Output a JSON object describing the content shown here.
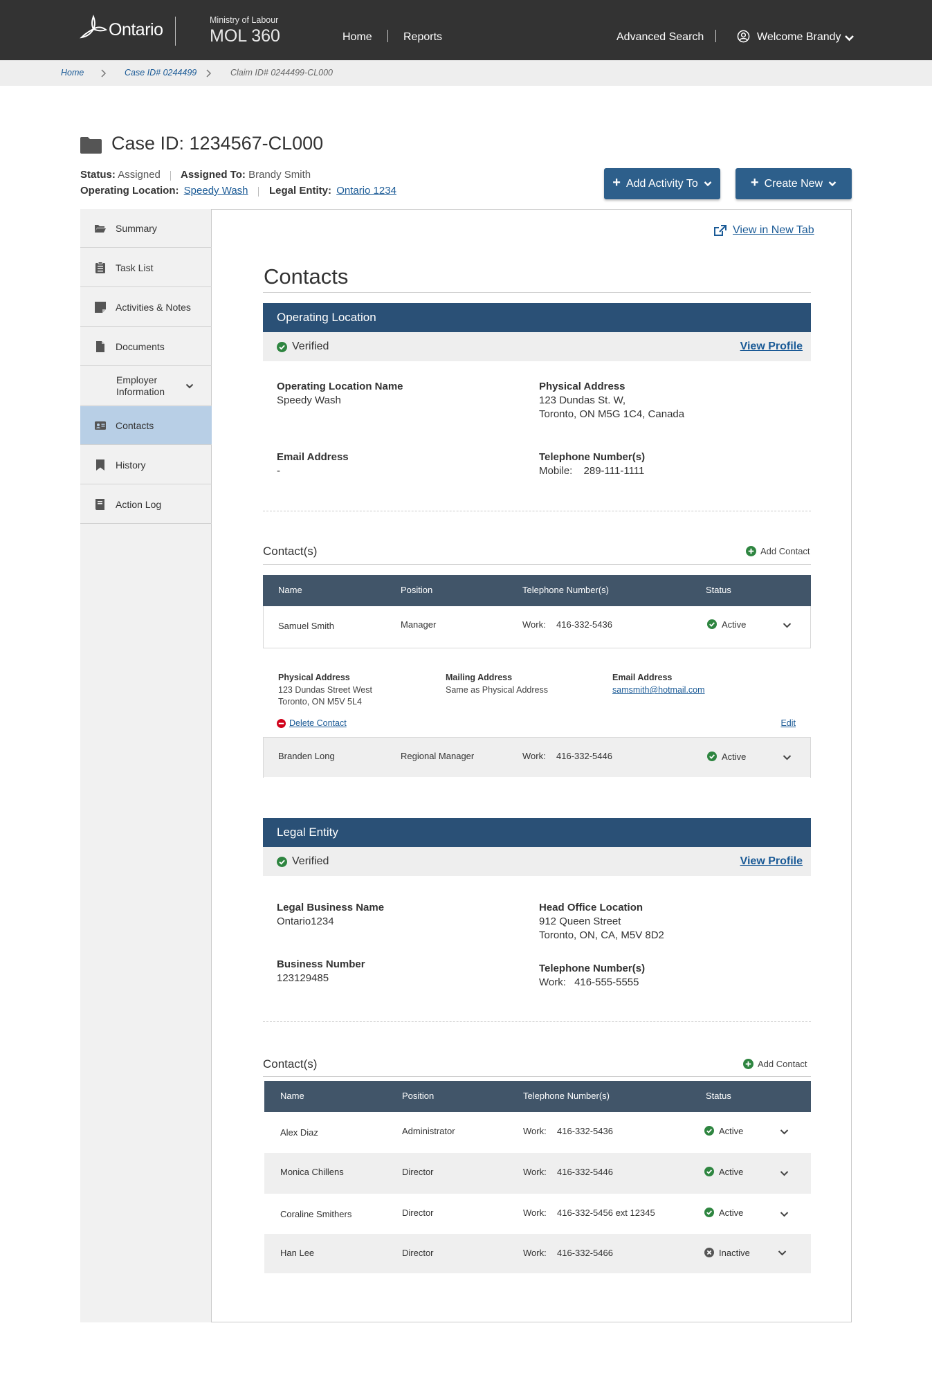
{
  "header": {
    "brand": "Ontario",
    "ministry_small": "Ministry of Labour",
    "ministry_app": "MOL 360",
    "nav_home": "Home",
    "nav_reports": "Reports",
    "advanced_search": "Advanced Search",
    "welcome": "Welcome Brandy"
  },
  "breadcrumb": {
    "home": "Home",
    "case": "Case ID# 0244499",
    "current": "Claim ID# 0244499-CL000"
  },
  "case": {
    "title": "Case ID: 1234567-CL000",
    "status_label": "Status:",
    "status_value": "Assigned",
    "assigned_label": "Assigned To:",
    "assigned_value": "Brandy Smith",
    "op_loc_label": "Operating Location:",
    "op_loc_value": "Speedy Wash",
    "legal_label": "Legal Entity:",
    "legal_value": "Ontario 1234",
    "add_activity": "Add Activity To",
    "create_new": "Create New"
  },
  "sidebar": {
    "items": [
      {
        "label": "Summary",
        "icon": "folder-open-icon"
      },
      {
        "label": "Task List",
        "icon": "clipboard-list-icon"
      },
      {
        "label": "Activities & Notes",
        "icon": "sticky-note-icon"
      },
      {
        "label": "Documents",
        "icon": "document-icon"
      },
      {
        "label": "Employer Information",
        "label_line1": "Employer",
        "label_line2": "Information"
      },
      {
        "label": "Contacts",
        "icon": "id-card-icon"
      },
      {
        "label": "History",
        "icon": "bookmark-icon"
      },
      {
        "label": "Action Log",
        "icon": "book-icon"
      }
    ]
  },
  "content": {
    "view_new_tab": "View in New Tab",
    "title": "Contacts",
    "operating_location": {
      "heading": "Operating Location",
      "verified": "Verified",
      "view_profile": "View Profile",
      "name_label": "Operating Location Name",
      "name_value": "Speedy Wash",
      "address_label": "Physical Address",
      "address_line1": "123 Dundas St. W,",
      "address_line2": "Toronto, ON M5G 1C4, Canada",
      "email_label": "Email Address",
      "email_value": "-",
      "phone_label": "Telephone Number(s)",
      "phone_type": "Mobile:",
      "phone_value": "289-111-1111"
    },
    "op_contacts": {
      "heading": "Contact(s)",
      "add_contact": "Add Contact",
      "columns": [
        "Name",
        "Position",
        "Telephone Number(s)",
        "Status"
      ],
      "rows": [
        {
          "name": "Samuel Smith",
          "position": "Manager",
          "phone_type": "Work:",
          "phone": "416-332-5436",
          "status": "Active"
        },
        {
          "name": "Branden Long",
          "position": "Regional Manager",
          "phone_type": "Work:",
          "phone": "416-332-5446",
          "status": "Active"
        }
      ],
      "detail": {
        "phys_label": "Physical Address",
        "phys_line1": "123 Dundas Street West",
        "phys_line2": "Toronto, ON M5V 5L4",
        "mail_label": "Mailing  Address",
        "mail_value": "Same as Physical Address",
        "email_label": "Email Address",
        "email_value": "samsmith@hotmail.com",
        "delete": "Delete Contact",
        "edit": "Edit"
      }
    },
    "legal_entity": {
      "heading": "Legal Entity",
      "verified": "Verified",
      "view_profile": "View Profile",
      "name_label": "Legal Business Name",
      "name_value": "Ontario1234",
      "office_label": "Head Office Location",
      "office_line1": "912 Queen Street",
      "office_line2": "Toronto, ON, CA, M5V 8D2",
      "bn_label": "Business Number",
      "bn_value": "123129485",
      "phone_label": "Telephone Number(s)",
      "phone_type": "Work:",
      "phone_value": "416-555-5555"
    },
    "le_contacts": {
      "heading": "Contact(s)",
      "add_contact": "Add Contact",
      "columns": [
        "Name",
        "Position",
        "Telephone Number(s)",
        "Status"
      ],
      "rows": [
        {
          "name": "Alex Diaz",
          "position": "Administrator",
          "phone_type": "Work:",
          "phone": "416-332-5436",
          "status": "Active"
        },
        {
          "name": "Monica Chillens",
          "position": "Director",
          "phone_type": "Work:",
          "phone": "416-332-5446",
          "status": "Active"
        },
        {
          "name": "Coraline Smithers",
          "position": "Director",
          "phone_type": "Work:",
          "phone": "416-332-5456 ext 12345",
          "status": "Active"
        },
        {
          "name": "Han Lee",
          "position": "Director",
          "phone_type": "Work:",
          "phone": "416-332-5466",
          "status": "Inactive"
        }
      ]
    }
  },
  "colors": {
    "header_bg": "#333333",
    "primary_button": "#2d5f8b",
    "section_header": "#2a5076",
    "table_header": "#415569",
    "link": "#1a5a96",
    "active_nav": "#b8cfe6",
    "success": "#2e8540",
    "danger": "#d0021b",
    "inactive": "#555555"
  }
}
